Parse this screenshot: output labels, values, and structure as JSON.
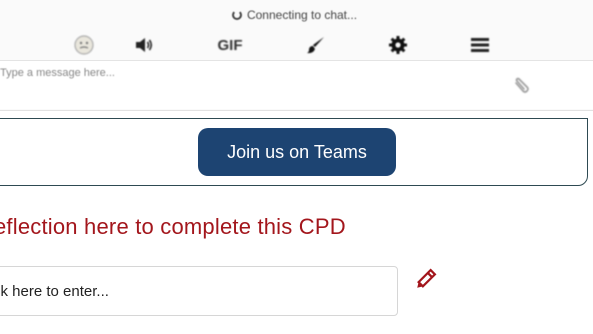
{
  "chat": {
    "status_text": "Connecting to chat...",
    "toolbar": {
      "gif_label": "GIF"
    },
    "input_placeholder": "Type a message here..."
  },
  "teams": {
    "button_label": "Join us on Teams",
    "button_color": "#1d4472"
  },
  "reflection": {
    "heading": "eflection here to complete this CPD",
    "heading_color": "#a3161c",
    "input_placeholder": "ck here to enter..."
  },
  "icons": {
    "emoji": "smiley-icon",
    "sound": "speaker-icon",
    "paint": "paintbrush-icon",
    "settings": "gear-icon",
    "menu": "hamburger-menu-icon",
    "attach": "paperclip-icon",
    "edit": "pencil-icon"
  }
}
